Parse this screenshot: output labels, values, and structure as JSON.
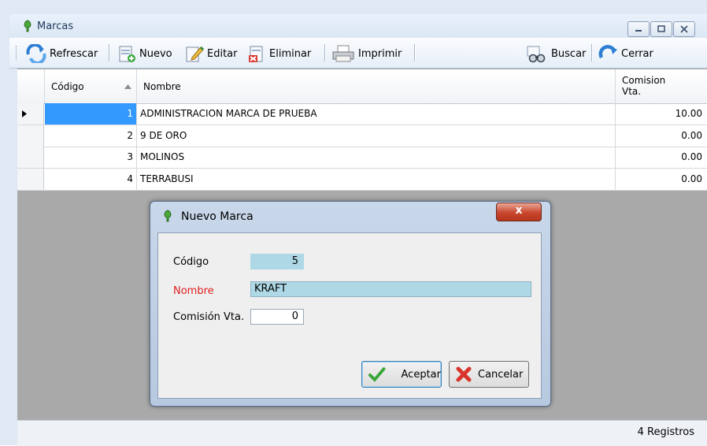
{
  "window": {
    "title": "Marcas",
    "icon": "leaf-icon"
  },
  "toolbar": {
    "refresh_label": "Refrescar",
    "new_label": "Nuevo",
    "edit_label": "Editar",
    "delete_label": "Eliminar",
    "print_label": "Imprimir",
    "search_label": "Buscar",
    "close_label": "Cerrar"
  },
  "grid": {
    "columns": [
      "Código",
      "Nombre",
      "Comision Vta."
    ],
    "comision_header_line1": "Comision",
    "comision_header_line2": "Vta.",
    "sort_column": "Código",
    "rows": [
      {
        "codigo": "1",
        "nombre": "ADMINISTRACION MARCA DE PRUEBA",
        "comision": "10.00",
        "selected": true
      },
      {
        "codigo": "2",
        "nombre": "9 DE ORO",
        "comision": "0.00",
        "selected": false
      },
      {
        "codigo": "3",
        "nombre": "MOLINOS",
        "comision": "0.00",
        "selected": false
      },
      {
        "codigo": "4",
        "nombre": "TERRABUSI",
        "comision": "0.00",
        "selected": false
      }
    ]
  },
  "status": {
    "text": "4 Registros"
  },
  "dialog": {
    "title": "Nuevo Marca",
    "close_label": "x",
    "codigo_label": "Código",
    "codigo_value": "5",
    "nombre_label": "Nombre",
    "nombre_value": "KRAFT",
    "comision_label": "Comisión Vta.",
    "comision_value": "0",
    "accept_label": "Aceptar",
    "cancel_label": "Cancelar"
  },
  "colors": {
    "selected_cell": "#3399ff",
    "required_label": "#e02020",
    "field_highlight": "#aed8e6"
  }
}
